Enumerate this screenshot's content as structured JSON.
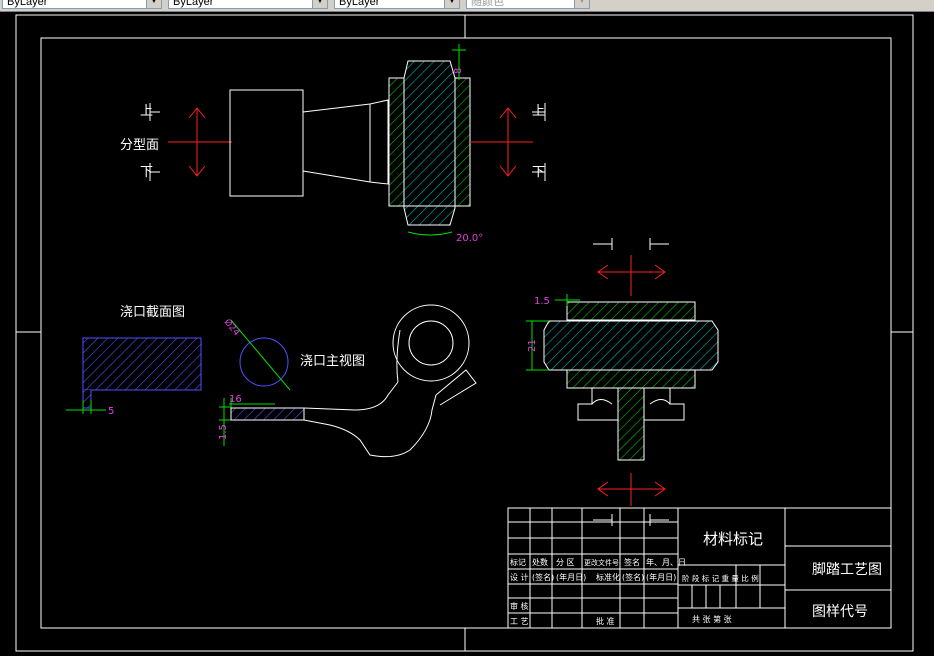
{
  "toolbar": {
    "layer_combo": "ByLayer",
    "linetype_combo": "ByLayer",
    "lineweight_combo": "ByLayer",
    "plotstyle_combo": "随颜色"
  },
  "drawing": {
    "labels": {
      "parting_surface": "分型面",
      "up": "上",
      "down": "下",
      "gate_section": "浇口截面图",
      "gate_main_view": "浇口主视图"
    },
    "dimensions": {
      "top_thickness": "8",
      "draft_angle": "20.0°",
      "gate_width": "5",
      "gate_diameter": "Ø24",
      "gate_length": "16",
      "gate_height": "1.5",
      "section_offset": "1.5",
      "section_height": "21"
    }
  },
  "title_block": {
    "grid_row_a": [
      "标记",
      "处数",
      "分 区",
      "更改文件号",
      "签名",
      "年、月、日"
    ],
    "grid_row_b": [
      "设 计",
      "(签名)",
      "(年月日)",
      "标准化",
      "(签名)",
      "(年月日)"
    ],
    "grid_row_c": [
      "审 核",
      "工 艺",
      "批 准"
    ],
    "material": "材料标记",
    "stage_labels": "阶 段 标 记  重 量  比 例",
    "sheet_labels": "共    张    第    张",
    "drawing_title": "脚踏工艺图",
    "drawing_number": "图样代号"
  }
}
